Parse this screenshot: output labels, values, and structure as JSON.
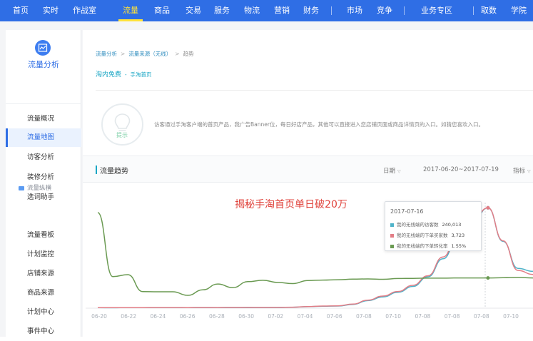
{
  "topnav": {
    "items": [
      "首页",
      "实时",
      "作战室",
      "流量",
      "商品",
      "交易",
      "服务",
      "物流",
      "营销",
      "财务",
      "市场",
      "竞争",
      "业务专区",
      "取数",
      "学院"
    ],
    "active_index": 3
  },
  "sidebar": {
    "title": "流量分析",
    "items": [
      "流量概况",
      "流量地图",
      "访客分析",
      "装修分析",
      "选词助手"
    ],
    "active_index": 1,
    "group_title": "流量纵横",
    "group_items": [
      "流量看板",
      "计划监控",
      "店铺来源",
      "商品来源",
      "计划中心",
      "事件中心"
    ]
  },
  "breadcrumb": [
    "流量分析",
    "流量来源（无线）",
    "趋势"
  ],
  "subtitle": {
    "main": "淘内免费",
    "sub": "手淘首页"
  },
  "tip": {
    "label": "提示",
    "text": "访客通过手淘客户端的首页产品，我广告Banner位，每日好店产品，其他可以直接进入您店铺页面或商品详情页的入口。如猜您喜欢入口。"
  },
  "section": {
    "title": "流量趋势",
    "granularity": "日期",
    "date_range": "2017-06-20~2017-07-19",
    "metric": "指标"
  },
  "chart_data": {
    "type": "line",
    "annotation": "揭秘手淘首页单日破20万",
    "x": [
      "06-20",
      "06-21",
      "06-22",
      "06-23",
      "06-24",
      "06-25",
      "06-26",
      "06-27",
      "06-28",
      "06-29",
      "06-30",
      "07-01",
      "07-02",
      "07-03",
      "07-04",
      "07-05",
      "07-06",
      "07-07",
      "07-08",
      "07-09",
      "07-10",
      "07-11",
      "07-12",
      "07-13",
      "07-14",
      "07-15",
      "07-16",
      "07-17",
      "07-18",
      "07-19"
    ],
    "xtick_labels": [
      "06-20",
      "06-22",
      "06-24",
      "06-26",
      "06-28",
      "06-30",
      "07-02",
      "07-04",
      "07-06",
      "07-08",
      "07-10",
      "07-08",
      "07-08",
      "07-08",
      "07-10"
    ],
    "tooltip": {
      "date": "2017-07-16",
      "series": [
        {
          "name": "我的无线端的访客数",
          "value": "240,013",
          "color": "#4fb3c9"
        },
        {
          "name": "我的无线端的下单买家数",
          "value": "3,723",
          "color": "#e27d86"
        },
        {
          "name": "我的无线端的下单转化率",
          "value": "1.55%",
          "color": "#6a9a52"
        }
      ]
    },
    "series": [
      {
        "name": "我的无线端的访客数",
        "color": "#4fb3c9",
        "values": [
          1200,
          1100,
          1300,
          1250,
          1400,
          1350,
          1300,
          1500,
          1400,
          1450,
          1600,
          1550,
          1700,
          2200,
          3500,
          4800,
          5200,
          9000,
          18000,
          27000,
          38000,
          52000,
          75000,
          118000,
          168000,
          208000,
          240013,
          160000,
          95000,
          88000
        ]
      },
      {
        "name": "我的无线端的下单买家数",
        "color": "#e27d86",
        "values": [
          20,
          18,
          22,
          21,
          24,
          23,
          22,
          25,
          24,
          26,
          28,
          27,
          30,
          38,
          60,
          80,
          88,
          150,
          300,
          450,
          620,
          850,
          1200,
          1900,
          2700,
          3300,
          3723,
          2500,
          1400,
          1250
        ]
      },
      {
        "name": "我的无线端的下单转化率",
        "color": "#6a9a52",
        "values": [
          4.9,
          1.62,
          1.72,
          0.85,
          0.84,
          0.84,
          0.66,
          0.94,
          1.24,
          1.05,
          1.36,
          1.43,
          1.32,
          1.26,
          1.42,
          1.44,
          1.46,
          1.49,
          1.5,
          1.48,
          1.52,
          1.53,
          1.54,
          1.54,
          1.55,
          1.55,
          1.55,
          1.56,
          1.58,
          1.55
        ]
      }
    ]
  }
}
